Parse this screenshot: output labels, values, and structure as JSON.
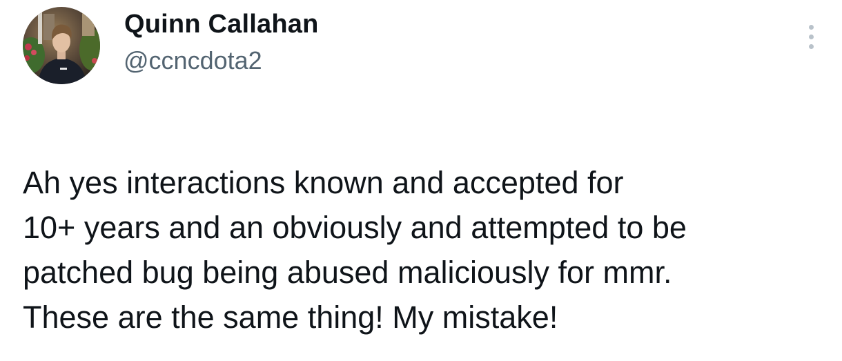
{
  "author": {
    "display_name": "Quinn Callahan",
    "handle": "@ccncdota2",
    "avatar_icon": "user-avatar-photo"
  },
  "tweet": {
    "text_lines": [
      "Ah yes interactions known and accepted for",
      "10+ years and an obviously and attempted to be",
      "patched bug being abused maliciously for mmr.",
      "These are the same thing! My mistake!"
    ]
  },
  "menu": {
    "icon": "more-options-icon"
  },
  "colors": {
    "text": "#0f1419",
    "secondary_text": "#536471",
    "icon_gray": "#b9c2ca",
    "background": "#ffffff"
  }
}
